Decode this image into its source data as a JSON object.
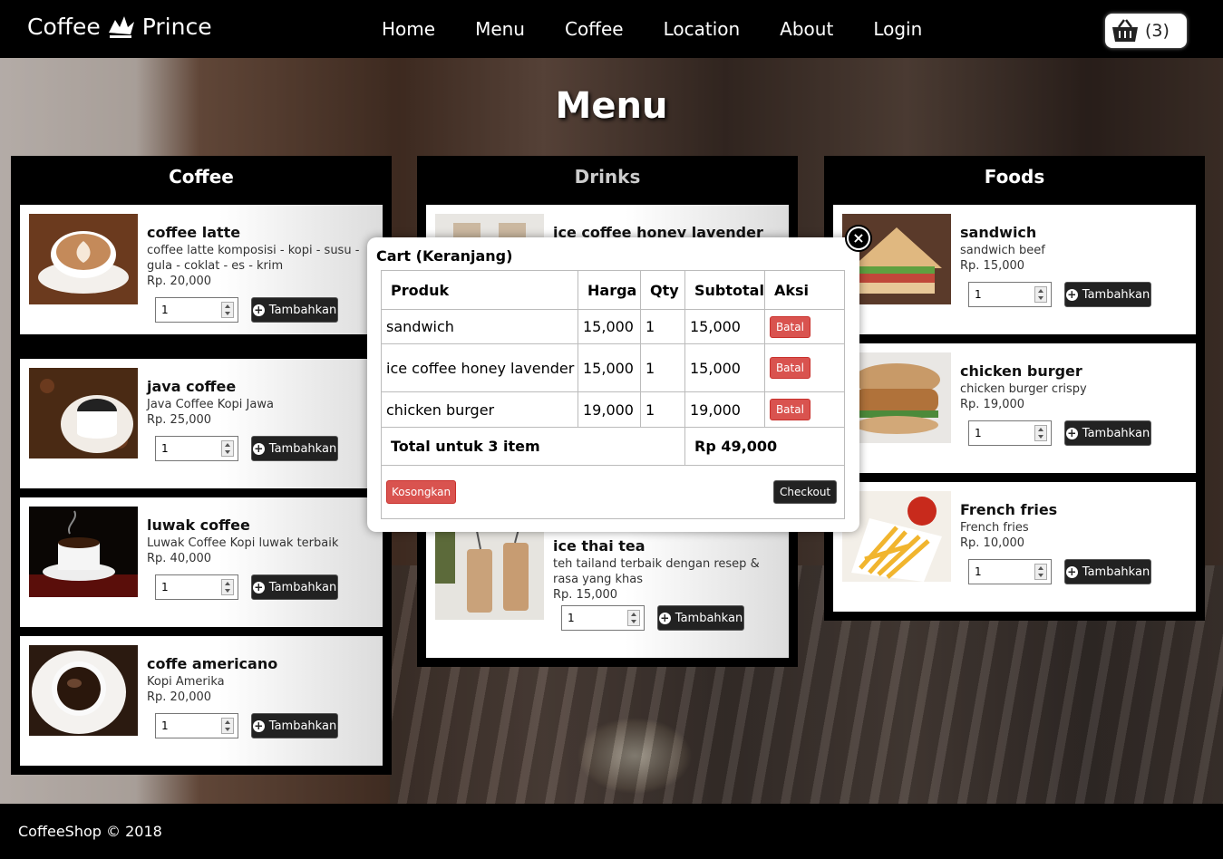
{
  "nav": {
    "brand_left": "Coffee",
    "brand_right": "Prince",
    "links": [
      "Home",
      "Menu",
      "Coffee",
      "Location",
      "About",
      "Login"
    ],
    "cart_count": "(3)"
  },
  "page_title": "Menu",
  "columns": {
    "coffee": {
      "title": "Coffee",
      "items": [
        {
          "name": "coffee latte",
          "desc": "coffee latte komposisi - kopi - susu - gula - coklat - es - krim",
          "price": "Rp. 20,000",
          "qty": "1",
          "button": "Tambahkan"
        },
        {
          "name": "java coffee",
          "desc": "Java Coffee Kopi Jawa",
          "price": "Rp. 25,000",
          "qty": "1",
          "button": "Tambahkan"
        },
        {
          "name": "luwak coffee",
          "desc": "Luwak Coffee Kopi luwak terbaik",
          "price": "Rp. 40,000",
          "qty": "1",
          "button": "Tambahkan"
        },
        {
          "name": "coffe americano",
          "desc": "Kopi Amerika",
          "price": "Rp. 20,000",
          "qty": "1",
          "button": "Tambahkan"
        }
      ]
    },
    "drinks": {
      "title": "Drinks",
      "items": [
        {
          "name": "ice coffee honey lavender"
        },
        {
          "name": "ice thai tea",
          "desc": "teh tailand terbaik dengan resep & rasa yang khas",
          "price": "Rp. 15,000",
          "qty": "1",
          "button": "Tambahkan"
        }
      ]
    },
    "foods": {
      "title": "Foods",
      "items": [
        {
          "name": "sandwich",
          "desc": "sandwich beef",
          "price": "Rp. 15,000",
          "qty": "1",
          "button": "Tambahkan"
        },
        {
          "name": "chicken burger",
          "desc": "chicken burger crispy",
          "price": "Rp. 19,000",
          "qty": "1",
          "button": "Tambahkan"
        },
        {
          "name": "French fries",
          "desc": "French fries",
          "price": "Rp. 10,000",
          "qty": "1",
          "button": "Tambahkan"
        }
      ]
    }
  },
  "cart": {
    "title": "Cart (Keranjang)",
    "headers": [
      "Produk",
      "Harga",
      "Qty",
      "Subtotal",
      "Aksi"
    ],
    "rows": [
      {
        "product": "sandwich",
        "price": "15,000",
        "qty": "1",
        "subtotal": "15,000",
        "action": "Batal"
      },
      {
        "product": "ice coffee honey lavender",
        "price": "15,000",
        "qty": "1",
        "subtotal": "15,000",
        "action": "Batal"
      },
      {
        "product": "chicken burger",
        "price": "19,000",
        "qty": "1",
        "subtotal": "19,000",
        "action": "Batal"
      }
    ],
    "total_label": "Total untuk 3 item",
    "total_value": "Rp 49,000",
    "empty_button": "Kosongkan",
    "checkout_button": "Checkout"
  },
  "footer": {
    "text": "CoffeeShop © 2018"
  },
  "colors": {
    "danger": "#d9534f",
    "dark": "#222222",
    "nav_bg": "#000000"
  }
}
